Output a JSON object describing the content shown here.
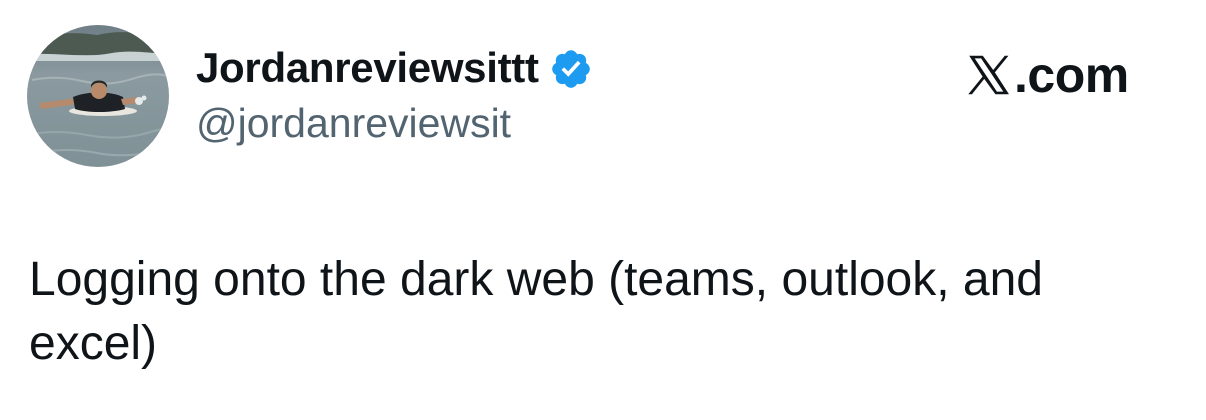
{
  "tweet": {
    "author": {
      "display_name": "Jordanreviewsittt",
      "handle": "@jordanreviewsit",
      "verified": true,
      "avatar_icon": "avatar-photo-surfer"
    },
    "source": {
      "icon": "x-logo-icon",
      "domain": ".com"
    },
    "text": "Logging onto the dark web (teams, outlook, and\nexcel)"
  },
  "colors": {
    "text_primary": "#0f1419",
    "text_secondary": "#536471",
    "verified_blue": "#1d9bf0",
    "background": "#ffffff"
  }
}
